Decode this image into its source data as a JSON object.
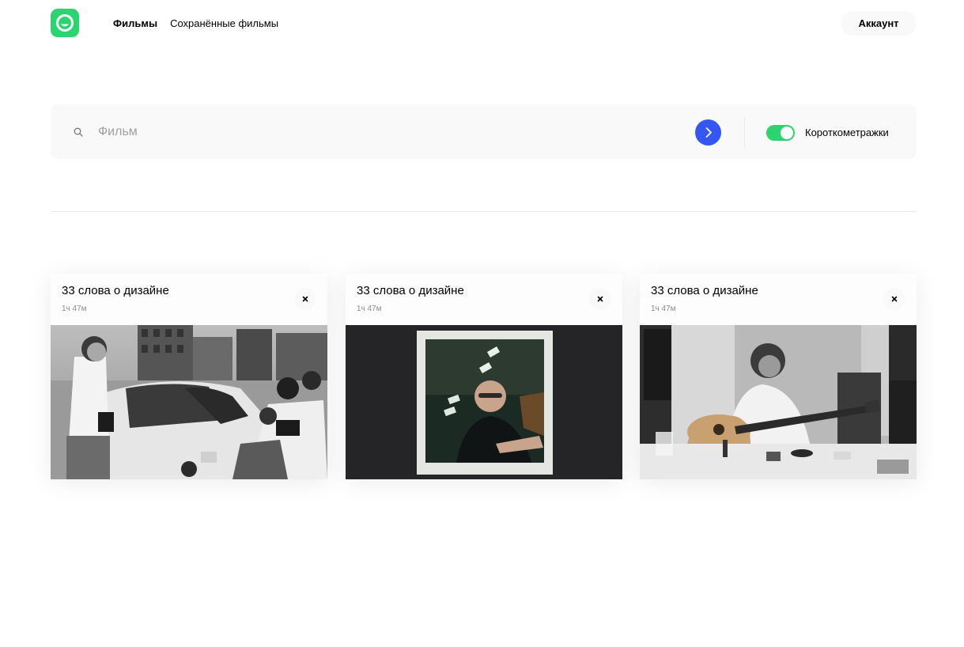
{
  "header": {
    "logo_icon": "smile-logo-icon",
    "nav": [
      {
        "label": "Фильмы",
        "active": true
      },
      {
        "label": "Сохранённые фильмы",
        "active": false
      }
    ],
    "account_label": "Аккаунт"
  },
  "search": {
    "placeholder": "Фильм",
    "value": "",
    "submit_icon": "chevron-right-icon",
    "shorts_toggle_on": true,
    "shorts_label": "Короткометражки"
  },
  "colors": {
    "brand_green": "#2bd46f",
    "accent_blue": "#3456f3"
  },
  "movies": [
    {
      "title": "33 слова о дизайне",
      "duration": "1ч 47м",
      "remove_icon": "close-icon",
      "image": "street-photo-image"
    },
    {
      "title": "33 слова о дизайне",
      "duration": "1ч 47м",
      "remove_icon": "close-icon",
      "image": "polaroid-portrait-image"
    },
    {
      "title": "33 слова о дизайне",
      "duration": "1ч 47м",
      "remove_icon": "close-icon",
      "image": "guitarist-photo-image"
    }
  ]
}
